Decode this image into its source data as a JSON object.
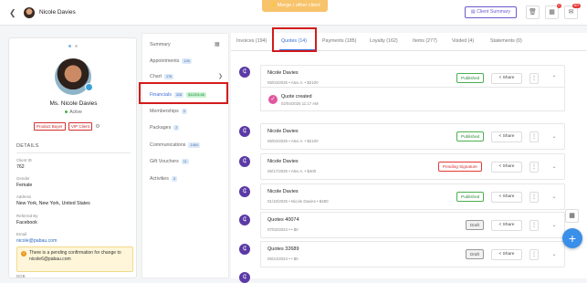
{
  "header": {
    "back_icon": "chevron-left-icon",
    "client_name": "Nicole Davies",
    "merge_label": "Merge / other client",
    "client_summary_label": "Client Summary",
    "icons": [
      "trash-icon",
      "notification-icon",
      "message-icon"
    ],
    "notification_badge": "0",
    "message_badge": "50+"
  },
  "profile": {
    "name": "Ms. Nicole Davies",
    "status": "Active",
    "tags": [
      "Product Buyer",
      "VIP Client"
    ],
    "details_heading": "DETAILS",
    "fields": [
      {
        "label": "Client ID",
        "value": "762",
        "link": false
      },
      {
        "label": "Gender",
        "value": "Female",
        "link": false
      },
      {
        "label": "Address",
        "value": "New York, New York, United States",
        "link": false
      },
      {
        "label": "Referred By",
        "value": "Facebook",
        "link": false
      },
      {
        "label": "Email",
        "value": "nicole@pabau.com",
        "link": true
      }
    ],
    "warning_text": "There is a pending confirmation for change to nicole6@pabau.com",
    "dob_label": "DOB"
  },
  "menu": {
    "summary": "Summary",
    "appointments": "Appointments",
    "appointments_count": "126",
    "chart": "Chart",
    "chart_count": "176",
    "financials": "Financials",
    "financials_count": "328",
    "financials_amount": "$11304.66",
    "memberships": "Memberships",
    "memberships_count": "0",
    "packages": "Packages",
    "packages_count": "2",
    "communications": "Communications",
    "communications_count": "1464",
    "gift_vouchers": "Gift Vouchers",
    "gift_vouchers_count": "11",
    "activities": "Activities",
    "activities_count": "3"
  },
  "tabs": [
    {
      "label": "Invoices (194)"
    },
    {
      "label": "Quotes (14)"
    },
    {
      "label": "Payments (185)"
    },
    {
      "label": "Loyalty (162)"
    },
    {
      "label": "Items (277)"
    },
    {
      "label": "Voided (4)"
    },
    {
      "label": "Statements (0)"
    }
  ],
  "quotes": [
    {
      "name": "Nicole Davies",
      "meta": "05/04/2025 • Alex A. • $2100",
      "status": "Published",
      "status_type": "pub",
      "expand_icon": "chevron-up-icon"
    },
    {
      "name": "Nicole Davies",
      "meta": "05/04/2025 • Alex A. • $2100",
      "status": "Published",
      "status_type": "pub",
      "expand_icon": "chevron-down-icon"
    },
    {
      "name": "Nicole Davies",
      "meta": "05/17/2025 • Alex A. • $400",
      "status": "Pending Signature",
      "status_type": "pend",
      "expand_icon": "chevron-down-icon"
    },
    {
      "name": "Nicole Davies",
      "meta": "01/10/2025 • Nicole Davies • $480",
      "status": "Published",
      "status_type": "pub",
      "expand_icon": "chevron-down-icon"
    },
    {
      "name": "Quotes 40074",
      "meta": "07/02/2024 • • $0",
      "status": "Draft",
      "status_type": "draft",
      "expand_icon": "chevron-down-icon"
    },
    {
      "name": "Quotes 32689",
      "meta": "05/24/2024 • • $0",
      "status": "Draft",
      "status_type": "draft",
      "expand_icon": "chevron-down-icon"
    }
  ],
  "quote_activity": {
    "title": "Quote created",
    "date": "02/04/2025 11:17 AM"
  },
  "share_label": "Share",
  "fab_icons": [
    "calendar-icon",
    "plus-icon"
  ]
}
